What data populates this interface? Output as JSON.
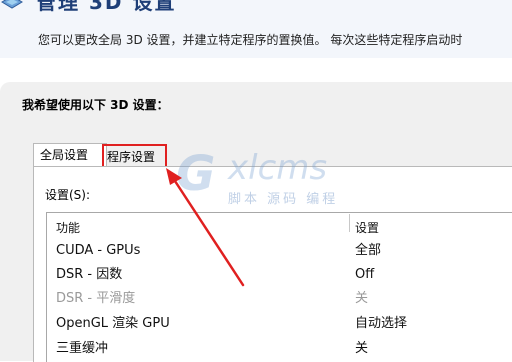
{
  "header": {
    "title": "管理 3D 设置",
    "description": "您可以更改全局 3D 设置，并建立特定程序的置换值。 每次这些特定程序启动时"
  },
  "section_heading": "我希望使用以下 3D 设置：",
  "tabs": [
    {
      "label": "全局设置",
      "active": true
    },
    {
      "label": "程序设置",
      "active": false,
      "highlighted": true
    }
  ],
  "settings_label": "设置(S):",
  "table": {
    "headers": {
      "feature": "功能",
      "setting": "设置"
    },
    "rows": [
      {
        "feature": "CUDA - GPUs",
        "setting": "全部",
        "disabled": false
      },
      {
        "feature": "DSR - 因数",
        "setting": "Off",
        "disabled": false
      },
      {
        "feature": "DSR - 平滑度",
        "setting": "关",
        "disabled": true
      },
      {
        "feature": "OpenGL 渲染 GPU",
        "setting": "自动选择",
        "disabled": false
      },
      {
        "feature": "三重缓冲",
        "setting": "关",
        "disabled": false
      }
    ]
  },
  "watermark": {
    "brand": "xlcms",
    "subtitle": "脚本 源码 编程"
  },
  "colors": {
    "highlight": "#e02020",
    "title": "#1f3f78"
  }
}
